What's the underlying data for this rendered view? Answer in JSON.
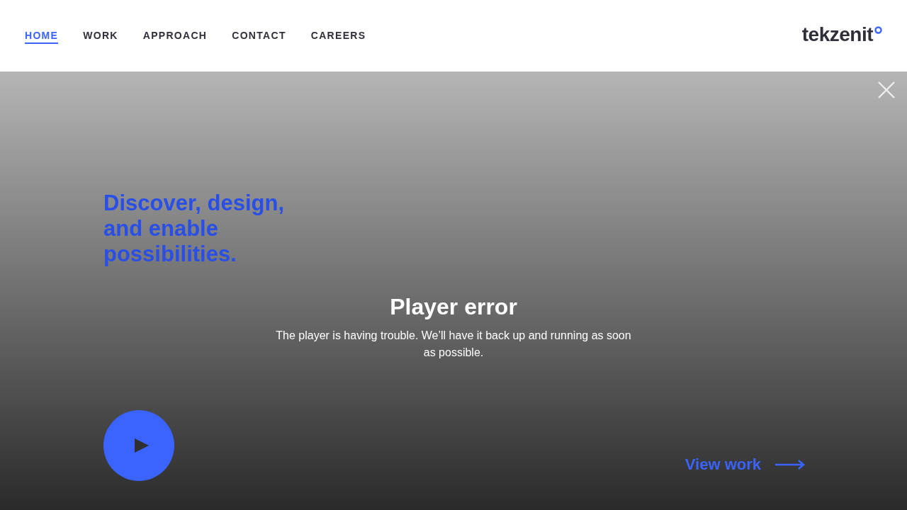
{
  "nav": [
    {
      "label": "HOME",
      "selected": true
    },
    {
      "label": "WORK",
      "selected": false
    },
    {
      "label": "APPROACH",
      "selected": false
    },
    {
      "label": "CONTACT",
      "selected": false
    },
    {
      "label": "CAREERS",
      "selected": false
    }
  ],
  "logo": {
    "text": "tekzenit"
  },
  "hero": {
    "headline": "Discover, design, and enable possibilities.",
    "error_title": "Player error",
    "error_message": "The player is having trouble. We’ll have it back up and running as soon as possible.",
    "view_work": "View work"
  }
}
